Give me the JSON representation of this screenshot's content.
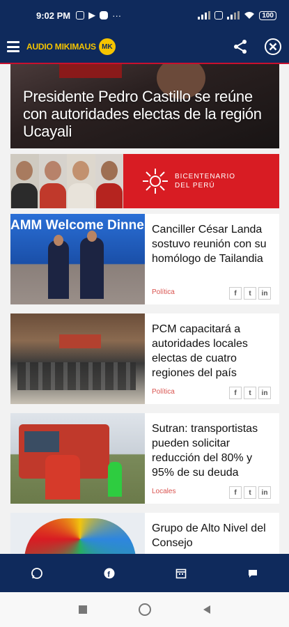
{
  "status_bar": {
    "time": "9:02 PM",
    "battery": "100"
  },
  "app_bar": {
    "logo_text": "AUDIO MIKIMAUS",
    "logo_badge": "MK",
    "menu_icon": "hamburger-menu-icon",
    "share_icon": "share-icon",
    "close_icon": "close-circle-icon"
  },
  "hero": {
    "title": "Presidente Pedro Castillo se reúne con autoridades electas de la región Ucayali"
  },
  "banner": {
    "line1": "BICENTENARIO",
    "line2": "DEL PERÚ"
  },
  "articles": [
    {
      "title": "Canciller César Landa sostuvo reunión con su homólogo de Tailandia",
      "category": "Política",
      "image_caption": "AMM Welcome Dinner"
    },
    {
      "title": "PCM capacitará a autoridades locales electas de cuatro regiones del país",
      "category": "Política"
    },
    {
      "title": "Sutran: transportistas pueden solicitar reducción del 80% y 95% de su deuda",
      "category": "Locales"
    },
    {
      "title": "Grupo de Alto Nivel del Consejo",
      "category": ""
    }
  ],
  "share_buttons": {
    "facebook": "f",
    "twitter": "t",
    "linkedin": "in"
  },
  "bottom_nav": [
    "whatsapp-icon",
    "facebook-icon",
    "calendar-icon",
    "chat-icon"
  ],
  "colors": {
    "brand_navy": "#0f2a5c",
    "accent_red": "#c8102e",
    "logo_yellow": "#f5c400",
    "category_red": "#d9534f"
  }
}
